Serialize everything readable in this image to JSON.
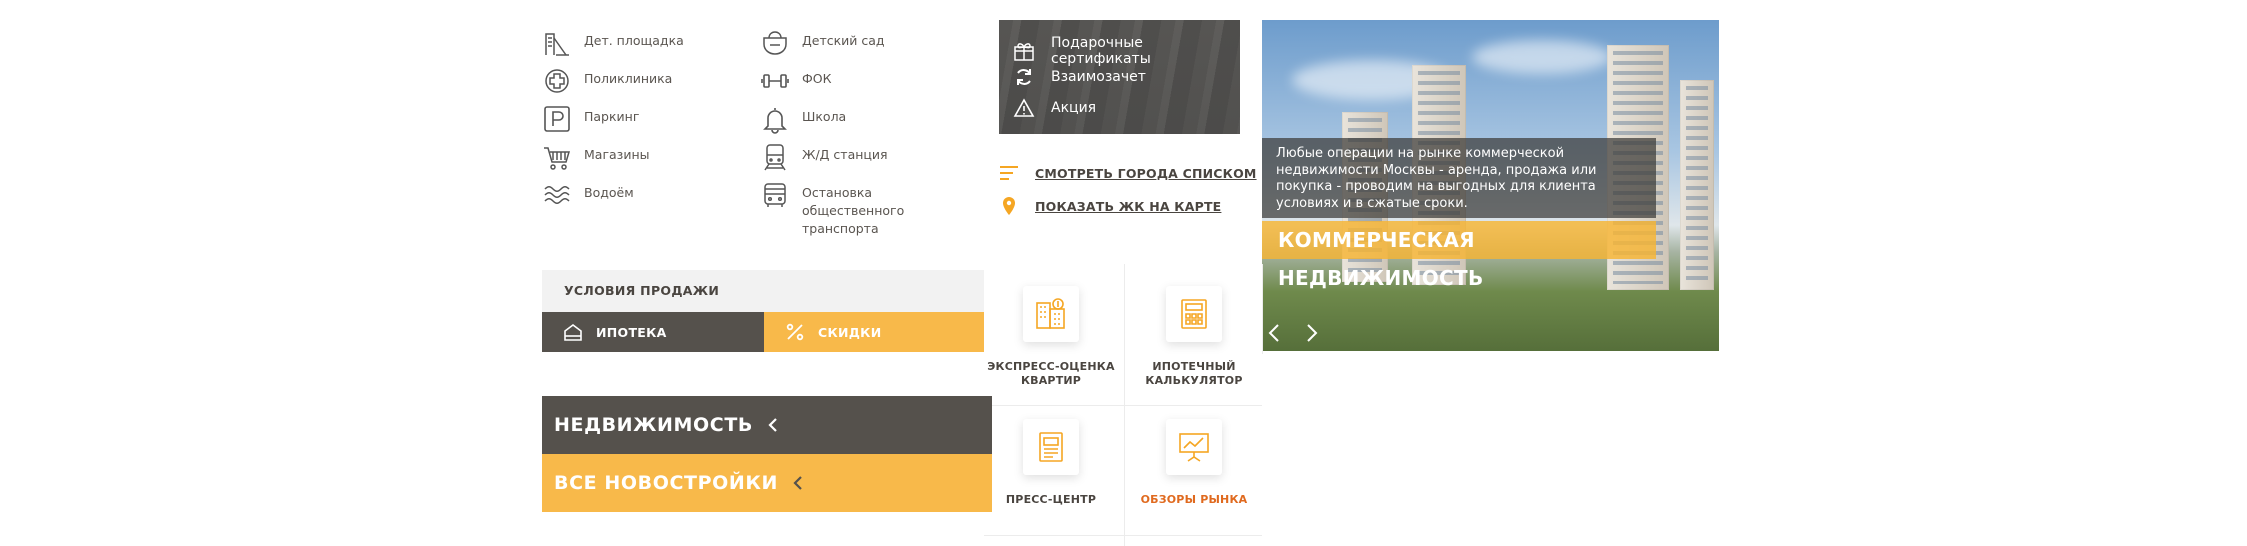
{
  "legend": {
    "col1": [
      {
        "icon": "playground-icon",
        "label": "Дет. площадка"
      },
      {
        "icon": "clinic-icon",
        "label": "Поликлиника"
      },
      {
        "icon": "parking-icon",
        "label": "Паркинг"
      },
      {
        "icon": "cart-icon",
        "label": "Магазины"
      },
      {
        "icon": "waves-icon",
        "label": "Водоём"
      }
    ],
    "col2": [
      {
        "icon": "kindergarten-icon",
        "label": "Детский сад"
      },
      {
        "icon": "dumbbell-icon",
        "label": "ФОК"
      },
      {
        "icon": "bell-icon",
        "label": "Школа"
      },
      {
        "icon": "train-icon",
        "label": "Ж/Д станция"
      },
      {
        "icon": "bus-icon",
        "label": "Остановка общественного транспорта"
      }
    ]
  },
  "gift_panel": {
    "items": [
      {
        "icon": "gift-icon",
        "label": "Подарочные сертификаты"
      },
      {
        "icon": "refresh-icon",
        "label": "Взаимозачет"
      },
      {
        "icon": "warning-icon",
        "label": "Акция"
      }
    ]
  },
  "links": {
    "list": "СМОТРЕТЬ ГОРОДА СПИСКОМ",
    "map": "ПОКАЗАТЬ ЖК НА КАРТЕ"
  },
  "promo": {
    "caption": "Любые операции на рынке коммерческой недвижимости Москвы - аренда, продажа или покупка - проводим на выгодных для клиента условиях и в сжатые сроки.",
    "title": "КОММЕРЧЕСКАЯ НЕДВИЖИМОСТЬ"
  },
  "sale": {
    "heading": "УСЛОВИЯ ПРОДАЖИ",
    "mortgage": "ИПОТЕКА",
    "discounts": "СКИДКИ"
  },
  "services": [
    {
      "icon": "building-valuation-icon",
      "label": "ЭКСПРЕСС-ОЦЕНКА КВАРТИР"
    },
    {
      "icon": "calculator-icon",
      "label": "ИПОТЕЧНЫЙ КАЛЬКУЛЯТОР"
    },
    {
      "icon": "newspaper-icon",
      "label": "ПРЕСС-ЦЕНТР"
    },
    {
      "icon": "presentation-chart-icon",
      "label": "ОБЗОРЫ РЫНКА"
    }
  ],
  "bars": {
    "realty": "НЕДВИЖИМОСТЬ",
    "newbuilds": "ВСЕ НОВОСТРОЙКИ"
  },
  "colors": {
    "dark": "#55514c",
    "accent": "#f8b94a",
    "text": "#4a4540",
    "highlight": "#e06a1f"
  }
}
